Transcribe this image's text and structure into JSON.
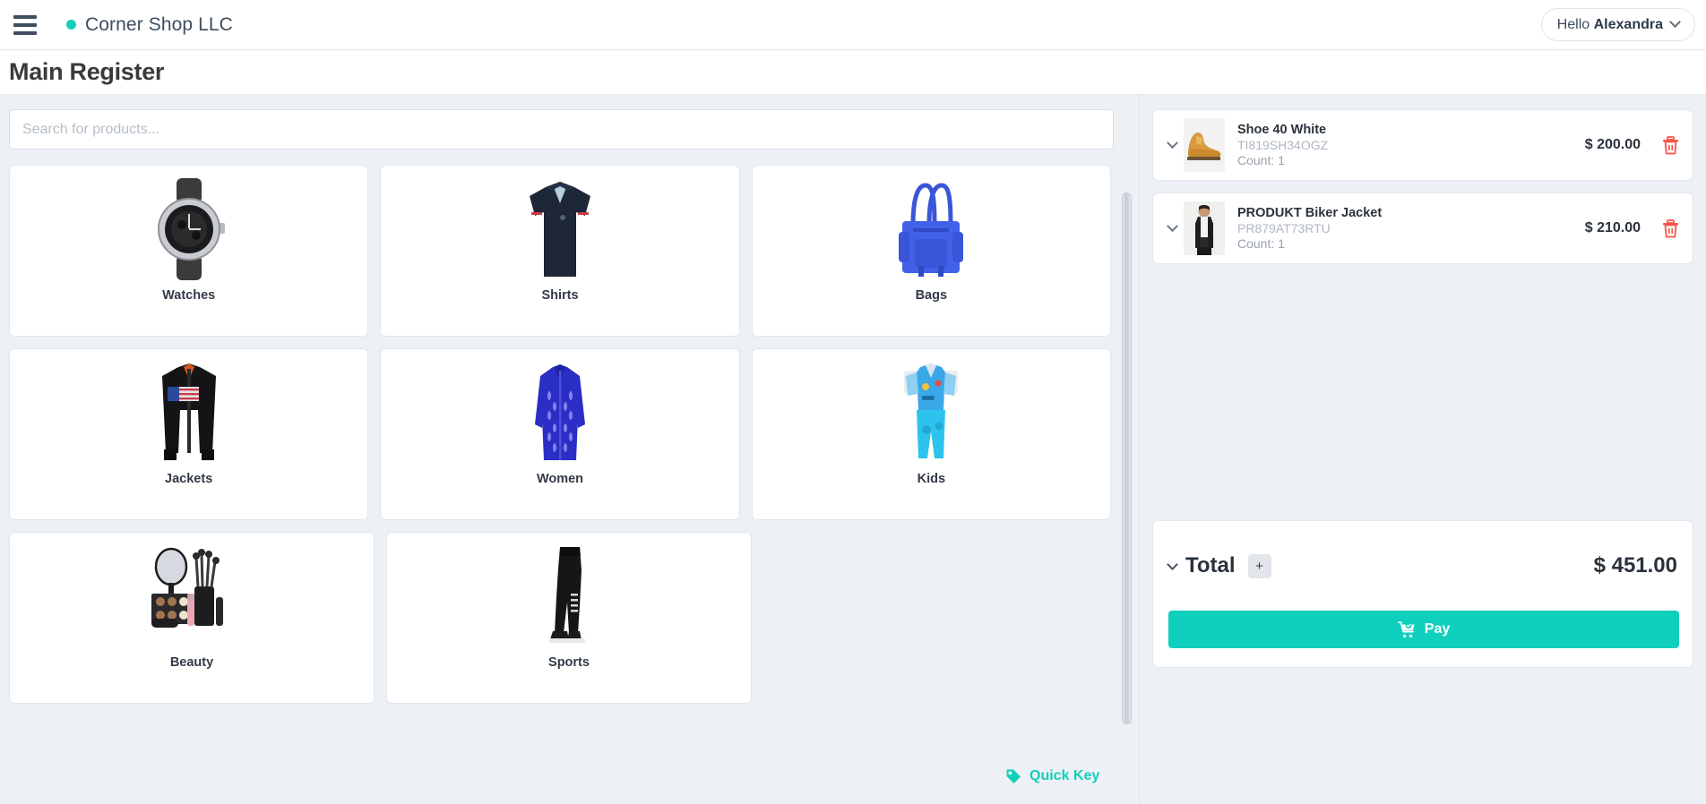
{
  "header": {
    "menu_icon": "hamburger-menu-icon",
    "status_dot_color": "#13cfb8",
    "shop_name": "Corner Shop LLC",
    "greeting_prefix": "Hello ",
    "user_name": "Alexandra",
    "user_chevron_icon": "chevron-down-icon"
  },
  "page": {
    "title": "Main Register",
    "background_color": "#edf0f5",
    "accent_color": "#0fcfbd"
  },
  "search": {
    "placeholder": "Search for products...",
    "value": ""
  },
  "categories": [
    {
      "label": "Watches",
      "icon": "watch-image"
    },
    {
      "label": "Shirts",
      "icon": "polo-shirt-image"
    },
    {
      "label": "Bags",
      "icon": "handbag-image"
    },
    {
      "label": "Jackets",
      "icon": "jacket-image"
    },
    {
      "label": "Women",
      "icon": "dress-image"
    },
    {
      "label": "Kids",
      "icon": "kids-outfit-image"
    },
    {
      "label": "Beauty",
      "icon": "cosmetics-image"
    },
    {
      "label": "Sports",
      "icon": "leggings-image"
    }
  ],
  "quick_key": {
    "label": "Quick Key",
    "icon": "tag-icon",
    "color": "#13cfb8"
  },
  "cart": {
    "items": [
      {
        "name": "Shoe 40 White",
        "sku": "TI819SH34OGZ",
        "count_label": "Count: 1",
        "price": "$ 200.00",
        "expand_icon": "chevron-down-icon",
        "delete_icon": "trash-icon",
        "thumb": "shoe-thumbnail"
      },
      {
        "name": "PRODUKT Biker Jacket",
        "sku": "PR879AT73RTU",
        "count_label": "Count: 1",
        "price": "$ 210.00",
        "expand_icon": "chevron-down-icon",
        "delete_icon": "trash-icon",
        "thumb": "jacket-thumbnail"
      }
    ],
    "total": {
      "label": "Total",
      "amount": "$ 451.00",
      "add_label": "+",
      "collapse_icon": "chevron-down-icon"
    },
    "pay_button": {
      "label": "Pay",
      "icon": "cart-check-icon",
      "color": "#0fcfbd"
    },
    "delete_icon_color": "#f8544b"
  }
}
